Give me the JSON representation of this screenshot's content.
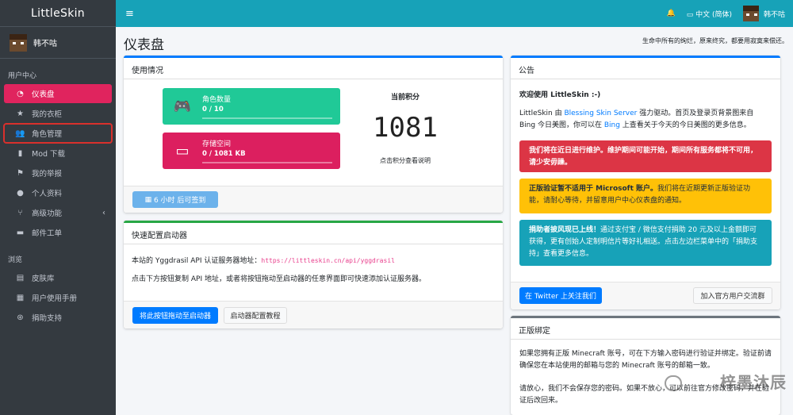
{
  "brand": "LittleSkin",
  "user": {
    "name": "韩不咕"
  },
  "sidebar": {
    "section_user": "用户中心",
    "section_explore": "浏览",
    "items": [
      {
        "label": "仪表盘",
        "icon": "dashboard-icon"
      },
      {
        "label": "我的衣柜",
        "icon": "star-icon"
      },
      {
        "label": "角色管理",
        "icon": "users-icon"
      },
      {
        "label": "Mod 下载",
        "icon": "book-icon"
      },
      {
        "label": "我的举报",
        "icon": "flag-icon"
      },
      {
        "label": "个人资料",
        "icon": "user-icon"
      },
      {
        "label": "高级功能",
        "icon": "branch-icon"
      },
      {
        "label": "邮件工单",
        "icon": "mail-icon"
      },
      {
        "label": "皮肤库",
        "icon": "archive-icon"
      },
      {
        "label": "用户使用手册",
        "icon": "manual-icon"
      },
      {
        "label": "捐助支持",
        "icon": "donate-icon"
      }
    ]
  },
  "topbar": {
    "language": "中文 (简体)",
    "username": "韩不咕"
  },
  "page": {
    "title": "仪表盘",
    "motto": "生命中所有的绚烂，原来终究，都要用寂寞来偿还。"
  },
  "usage": {
    "title": "使用情况",
    "players_label": "角色数量",
    "players_value": "0 / 10",
    "storage_label": "存储空间",
    "storage_value": "0 / 1081 KB",
    "score_title": "当前积分",
    "score_value": "1081",
    "score_hint": "点击积分查看说明",
    "sign_button": "6 小时 后可签到"
  },
  "launcher": {
    "title": "快速配置启动器",
    "line1_prefix": "本站的 Yggdrasil API 认证服务器地址：",
    "api_url": "https://littleskin.cn/api/yggdrasil",
    "line2": "点击下方按钮复制 API 地址，或者将按钮拖动至启动器的任意界面即可快速添加认证服务器。",
    "drag_button": "将此按钮拖动至启动器",
    "tutorial_button": "启动器配置教程"
  },
  "announcement": {
    "title": "公告",
    "welcome": "欢迎使用 LittleSkin :-)",
    "intro_a": "LittleSkin 由 ",
    "intro_link": "Blessing Skin Server",
    "intro_b": " 强力驱动。首页及登录页背景图来自 Bing 今日美图，你可以在 ",
    "intro_link2": "Bing",
    "intro_c": " 上查看关于今天的今日美图的更多信息。",
    "alert1": "我们将在近日进行维护。维护期间可能开始，期间所有服务都将不可用，请少安毋躁。",
    "alert2_bold": "正版验证暂不适用于 Microsoft 账户。",
    "alert2_rest": "我们将在近期更新正版验证功能，请耐心等待，并留意用户中心仪表盘的通知。",
    "alert3_bold": "捐助者披风现已上线！",
    "alert3_rest": "通过支付宝 / 微信支付捐助 20 元及以上金额即可获得，更有创始人定制明信片等好礼相送。点击左边栏菜单中的「捐助支持」查看更多信息。",
    "twitter_button": "在 Twitter 上关注我们",
    "group_button": "加入官方用户交流群"
  },
  "binding": {
    "title": "正版绑定",
    "p1": "如果您拥有正版 Minecraft 账号，可在下方输入密码进行验证并绑定。验证前请确保您在本站使用的邮箱与您的 Minecraft 账号的邮箱一致。",
    "p2": "请放心，我们不会保存您的密码。如果不放心，可以前往官方修改密码，并在验证后改回来。"
  },
  "watermark": "梓墨沐辰",
  "colors": {
    "sidebar": "#343a40",
    "topbar": "#17a2b8",
    "active": "#e0245e",
    "teal": "#20c997",
    "red": "#dc3545",
    "warning": "#ffc107",
    "info": "#17a2b8"
  }
}
